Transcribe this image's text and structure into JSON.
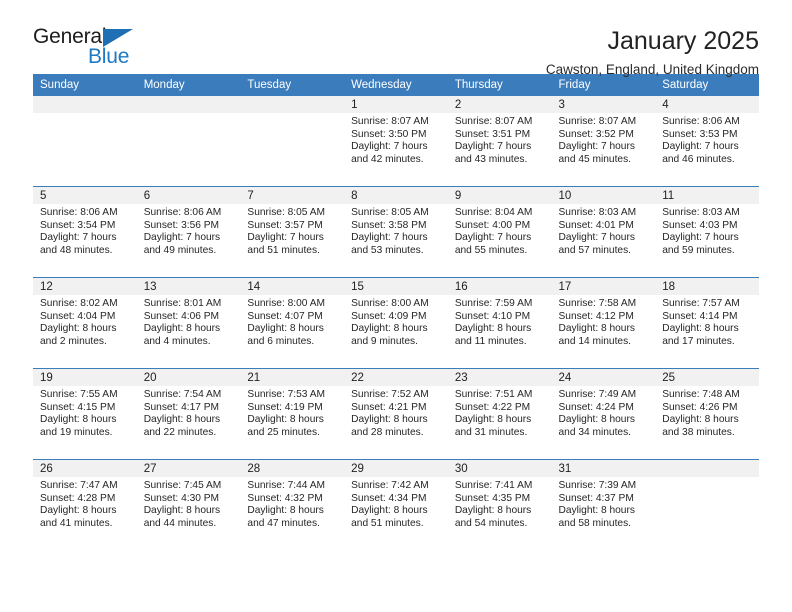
{
  "brand": {
    "name_top": "General",
    "name_bottom": "Blue",
    "triangle_color": "#1f6fb5",
    "blue_color": "#1f7ac4"
  },
  "header": {
    "title": "January 2025",
    "subtitle": "Cawston, England, United Kingdom"
  },
  "theme": {
    "header_bg": "#3b7cbd",
    "header_text": "#ffffff",
    "daynum_bg": "#f1f1f1",
    "cell_bg": "#ffffff",
    "grid_line": "#3b7cbd"
  },
  "weekday_headers": [
    "Sunday",
    "Monday",
    "Tuesday",
    "Wednesday",
    "Thursday",
    "Friday",
    "Saturday"
  ],
  "weeks": [
    [
      {
        "day": "",
        "sunrise": "",
        "sunset": "",
        "daylight_line1": "",
        "daylight_line2": ""
      },
      {
        "day": "",
        "sunrise": "",
        "sunset": "",
        "daylight_line1": "",
        "daylight_line2": ""
      },
      {
        "day": "",
        "sunrise": "",
        "sunset": "",
        "daylight_line1": "",
        "daylight_line2": ""
      },
      {
        "day": "1",
        "sunrise": "Sunrise: 8:07 AM",
        "sunset": "Sunset: 3:50 PM",
        "daylight_line1": "Daylight: 7 hours",
        "daylight_line2": "and 42 minutes."
      },
      {
        "day": "2",
        "sunrise": "Sunrise: 8:07 AM",
        "sunset": "Sunset: 3:51 PM",
        "daylight_line1": "Daylight: 7 hours",
        "daylight_line2": "and 43 minutes."
      },
      {
        "day": "3",
        "sunrise": "Sunrise: 8:07 AM",
        "sunset": "Sunset: 3:52 PM",
        "daylight_line1": "Daylight: 7 hours",
        "daylight_line2": "and 45 minutes."
      },
      {
        "day": "4",
        "sunrise": "Sunrise: 8:06 AM",
        "sunset": "Sunset: 3:53 PM",
        "daylight_line1": "Daylight: 7 hours",
        "daylight_line2": "and 46 minutes."
      }
    ],
    [
      {
        "day": "5",
        "sunrise": "Sunrise: 8:06 AM",
        "sunset": "Sunset: 3:54 PM",
        "daylight_line1": "Daylight: 7 hours",
        "daylight_line2": "and 48 minutes."
      },
      {
        "day": "6",
        "sunrise": "Sunrise: 8:06 AM",
        "sunset": "Sunset: 3:56 PM",
        "daylight_line1": "Daylight: 7 hours",
        "daylight_line2": "and 49 minutes."
      },
      {
        "day": "7",
        "sunrise": "Sunrise: 8:05 AM",
        "sunset": "Sunset: 3:57 PM",
        "daylight_line1": "Daylight: 7 hours",
        "daylight_line2": "and 51 minutes."
      },
      {
        "day": "8",
        "sunrise": "Sunrise: 8:05 AM",
        "sunset": "Sunset: 3:58 PM",
        "daylight_line1": "Daylight: 7 hours",
        "daylight_line2": "and 53 minutes."
      },
      {
        "day": "9",
        "sunrise": "Sunrise: 8:04 AM",
        "sunset": "Sunset: 4:00 PM",
        "daylight_line1": "Daylight: 7 hours",
        "daylight_line2": "and 55 minutes."
      },
      {
        "day": "10",
        "sunrise": "Sunrise: 8:03 AM",
        "sunset": "Sunset: 4:01 PM",
        "daylight_line1": "Daylight: 7 hours",
        "daylight_line2": "and 57 minutes."
      },
      {
        "day": "11",
        "sunrise": "Sunrise: 8:03 AM",
        "sunset": "Sunset: 4:03 PM",
        "daylight_line1": "Daylight: 7 hours",
        "daylight_line2": "and 59 minutes."
      }
    ],
    [
      {
        "day": "12",
        "sunrise": "Sunrise: 8:02 AM",
        "sunset": "Sunset: 4:04 PM",
        "daylight_line1": "Daylight: 8 hours",
        "daylight_line2": "and 2 minutes."
      },
      {
        "day": "13",
        "sunrise": "Sunrise: 8:01 AM",
        "sunset": "Sunset: 4:06 PM",
        "daylight_line1": "Daylight: 8 hours",
        "daylight_line2": "and 4 minutes."
      },
      {
        "day": "14",
        "sunrise": "Sunrise: 8:00 AM",
        "sunset": "Sunset: 4:07 PM",
        "daylight_line1": "Daylight: 8 hours",
        "daylight_line2": "and 6 minutes."
      },
      {
        "day": "15",
        "sunrise": "Sunrise: 8:00 AM",
        "sunset": "Sunset: 4:09 PM",
        "daylight_line1": "Daylight: 8 hours",
        "daylight_line2": "and 9 minutes."
      },
      {
        "day": "16",
        "sunrise": "Sunrise: 7:59 AM",
        "sunset": "Sunset: 4:10 PM",
        "daylight_line1": "Daylight: 8 hours",
        "daylight_line2": "and 11 minutes."
      },
      {
        "day": "17",
        "sunrise": "Sunrise: 7:58 AM",
        "sunset": "Sunset: 4:12 PM",
        "daylight_line1": "Daylight: 8 hours",
        "daylight_line2": "and 14 minutes."
      },
      {
        "day": "18",
        "sunrise": "Sunrise: 7:57 AM",
        "sunset": "Sunset: 4:14 PM",
        "daylight_line1": "Daylight: 8 hours",
        "daylight_line2": "and 17 minutes."
      }
    ],
    [
      {
        "day": "19",
        "sunrise": "Sunrise: 7:55 AM",
        "sunset": "Sunset: 4:15 PM",
        "daylight_line1": "Daylight: 8 hours",
        "daylight_line2": "and 19 minutes."
      },
      {
        "day": "20",
        "sunrise": "Sunrise: 7:54 AM",
        "sunset": "Sunset: 4:17 PM",
        "daylight_line1": "Daylight: 8 hours",
        "daylight_line2": "and 22 minutes."
      },
      {
        "day": "21",
        "sunrise": "Sunrise: 7:53 AM",
        "sunset": "Sunset: 4:19 PM",
        "daylight_line1": "Daylight: 8 hours",
        "daylight_line2": "and 25 minutes."
      },
      {
        "day": "22",
        "sunrise": "Sunrise: 7:52 AM",
        "sunset": "Sunset: 4:21 PM",
        "daylight_line1": "Daylight: 8 hours",
        "daylight_line2": "and 28 minutes."
      },
      {
        "day": "23",
        "sunrise": "Sunrise: 7:51 AM",
        "sunset": "Sunset: 4:22 PM",
        "daylight_line1": "Daylight: 8 hours",
        "daylight_line2": "and 31 minutes."
      },
      {
        "day": "24",
        "sunrise": "Sunrise: 7:49 AM",
        "sunset": "Sunset: 4:24 PM",
        "daylight_line1": "Daylight: 8 hours",
        "daylight_line2": "and 34 minutes."
      },
      {
        "day": "25",
        "sunrise": "Sunrise: 7:48 AM",
        "sunset": "Sunset: 4:26 PM",
        "daylight_line1": "Daylight: 8 hours",
        "daylight_line2": "and 38 minutes."
      }
    ],
    [
      {
        "day": "26",
        "sunrise": "Sunrise: 7:47 AM",
        "sunset": "Sunset: 4:28 PM",
        "daylight_line1": "Daylight: 8 hours",
        "daylight_line2": "and 41 minutes."
      },
      {
        "day": "27",
        "sunrise": "Sunrise: 7:45 AM",
        "sunset": "Sunset: 4:30 PM",
        "daylight_line1": "Daylight: 8 hours",
        "daylight_line2": "and 44 minutes."
      },
      {
        "day": "28",
        "sunrise": "Sunrise: 7:44 AM",
        "sunset": "Sunset: 4:32 PM",
        "daylight_line1": "Daylight: 8 hours",
        "daylight_line2": "and 47 minutes."
      },
      {
        "day": "29",
        "sunrise": "Sunrise: 7:42 AM",
        "sunset": "Sunset: 4:34 PM",
        "daylight_line1": "Daylight: 8 hours",
        "daylight_line2": "and 51 minutes."
      },
      {
        "day": "30",
        "sunrise": "Sunrise: 7:41 AM",
        "sunset": "Sunset: 4:35 PM",
        "daylight_line1": "Daylight: 8 hours",
        "daylight_line2": "and 54 minutes."
      },
      {
        "day": "31",
        "sunrise": "Sunrise: 7:39 AM",
        "sunset": "Sunset: 4:37 PM",
        "daylight_line1": "Daylight: 8 hours",
        "daylight_line2": "and 58 minutes."
      },
      {
        "day": "",
        "sunrise": "",
        "sunset": "",
        "daylight_line1": "",
        "daylight_line2": ""
      }
    ]
  ]
}
